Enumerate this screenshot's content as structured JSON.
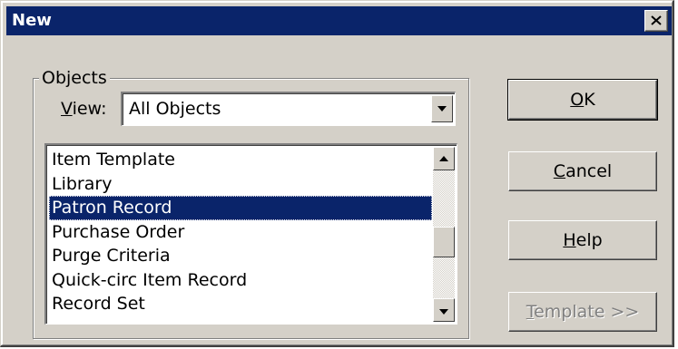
{
  "window": {
    "title": "New"
  },
  "objects_group": {
    "legend": "Objects",
    "view_label_accel": "V",
    "view_label_rest": "iew:",
    "view_value": "All Objects"
  },
  "object_list": {
    "items": [
      "Item Template",
      "Library",
      "Patron Record",
      "Purchase Order",
      "Purge Criteria",
      "Quick-circ Item Record",
      "Record Set"
    ],
    "selected": "Patron Record"
  },
  "buttons": {
    "ok_accel": "O",
    "ok_rest": "K",
    "cancel_accel": "C",
    "cancel_rest": "ancel",
    "help_accel": "H",
    "help_rest": "elp",
    "template_accel": "T",
    "template_rest": "emplate >>"
  },
  "colors": {
    "titlebar": "#0a246a",
    "face": "#d4d0c8",
    "selection": "#0a246a"
  },
  "icons": {
    "close": "close-icon",
    "dropdown": "chevron-down-icon",
    "scroll_up": "scroll-up-icon",
    "scroll_down": "scroll-down-icon"
  }
}
